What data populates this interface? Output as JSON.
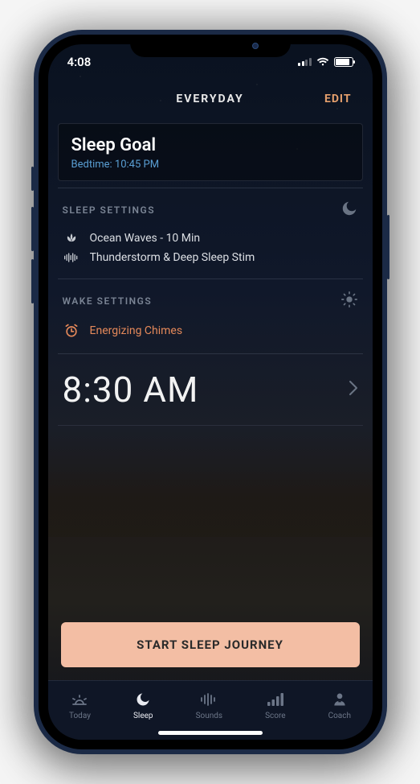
{
  "status": {
    "time": "4:08"
  },
  "header": {
    "title": "EVERYDAY",
    "edit": "EDIT"
  },
  "goal": {
    "title": "Sleep Goal",
    "subtitle": "Bedtime: 10:45 PM"
  },
  "sleep_settings": {
    "label": "SLEEP SETTINGS",
    "rows": [
      {
        "text": "Ocean Waves - 10 Min"
      },
      {
        "text": "Thunderstorm & Deep Sleep Stim"
      }
    ]
  },
  "wake_settings": {
    "label": "WAKE SETTINGS",
    "rows": [
      {
        "text": "Energizing Chimes"
      }
    ]
  },
  "wake_time": "8:30 AM",
  "cta": "START SLEEP JOURNEY",
  "tabs": {
    "today": "Today",
    "sleep": "Sleep",
    "sounds": "Sounds",
    "score": "Score",
    "coach": "Coach"
  }
}
